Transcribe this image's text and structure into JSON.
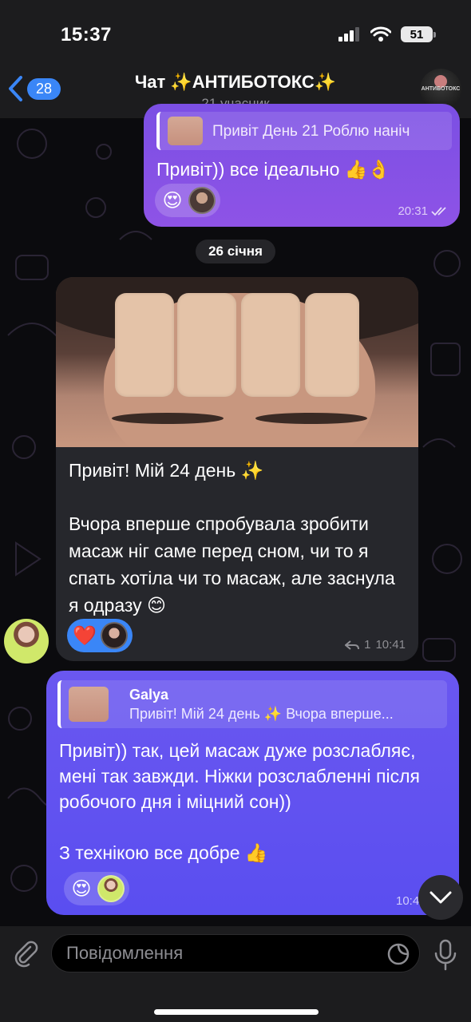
{
  "status": {
    "time": "15:37",
    "battery": "51"
  },
  "header": {
    "back_count": "28",
    "title": "Чат ✨АНТИБОТОКС✨",
    "subtitle": "21 учасник",
    "avatar_text": "АНТИБОТОКС"
  },
  "messages": {
    "out1": {
      "reply_text": "Привіт День 21 Роблю наніч",
      "text": "Привіт)) все ідеально 👍👌",
      "reaction": "😍",
      "time": "20:31"
    },
    "date": "26 січня",
    "in1": {
      "line1": "Привіт! Мій 24 день ✨",
      "body": "Вчора вперше спробувала зробити масаж ніг саме перед сном, чи то я спать хотіла чи то масаж, але заснула я одразу 😊",
      "reaction": "❤️",
      "replies": "1",
      "time": "10:41"
    },
    "out2": {
      "reply_name": "Galya",
      "reply_text": "Привіт! Мій 24 день ✨ Вчора вперше...",
      "text": "Привіт)) так, цей масаж дуже розслабляє, мені так завжди. Ніжки розслабленні після робочого дня і міцний сон))",
      "text2": "З технікою все добре 👍",
      "reaction": "😍",
      "time": "10:4"
    }
  },
  "input": {
    "placeholder": "Повідомлення"
  },
  "colors": {
    "accent": "#3a86f7",
    "bubble_out1": "#8552e5",
    "bubble_out2": "#5f52f0",
    "bubble_in": "#26272c"
  }
}
